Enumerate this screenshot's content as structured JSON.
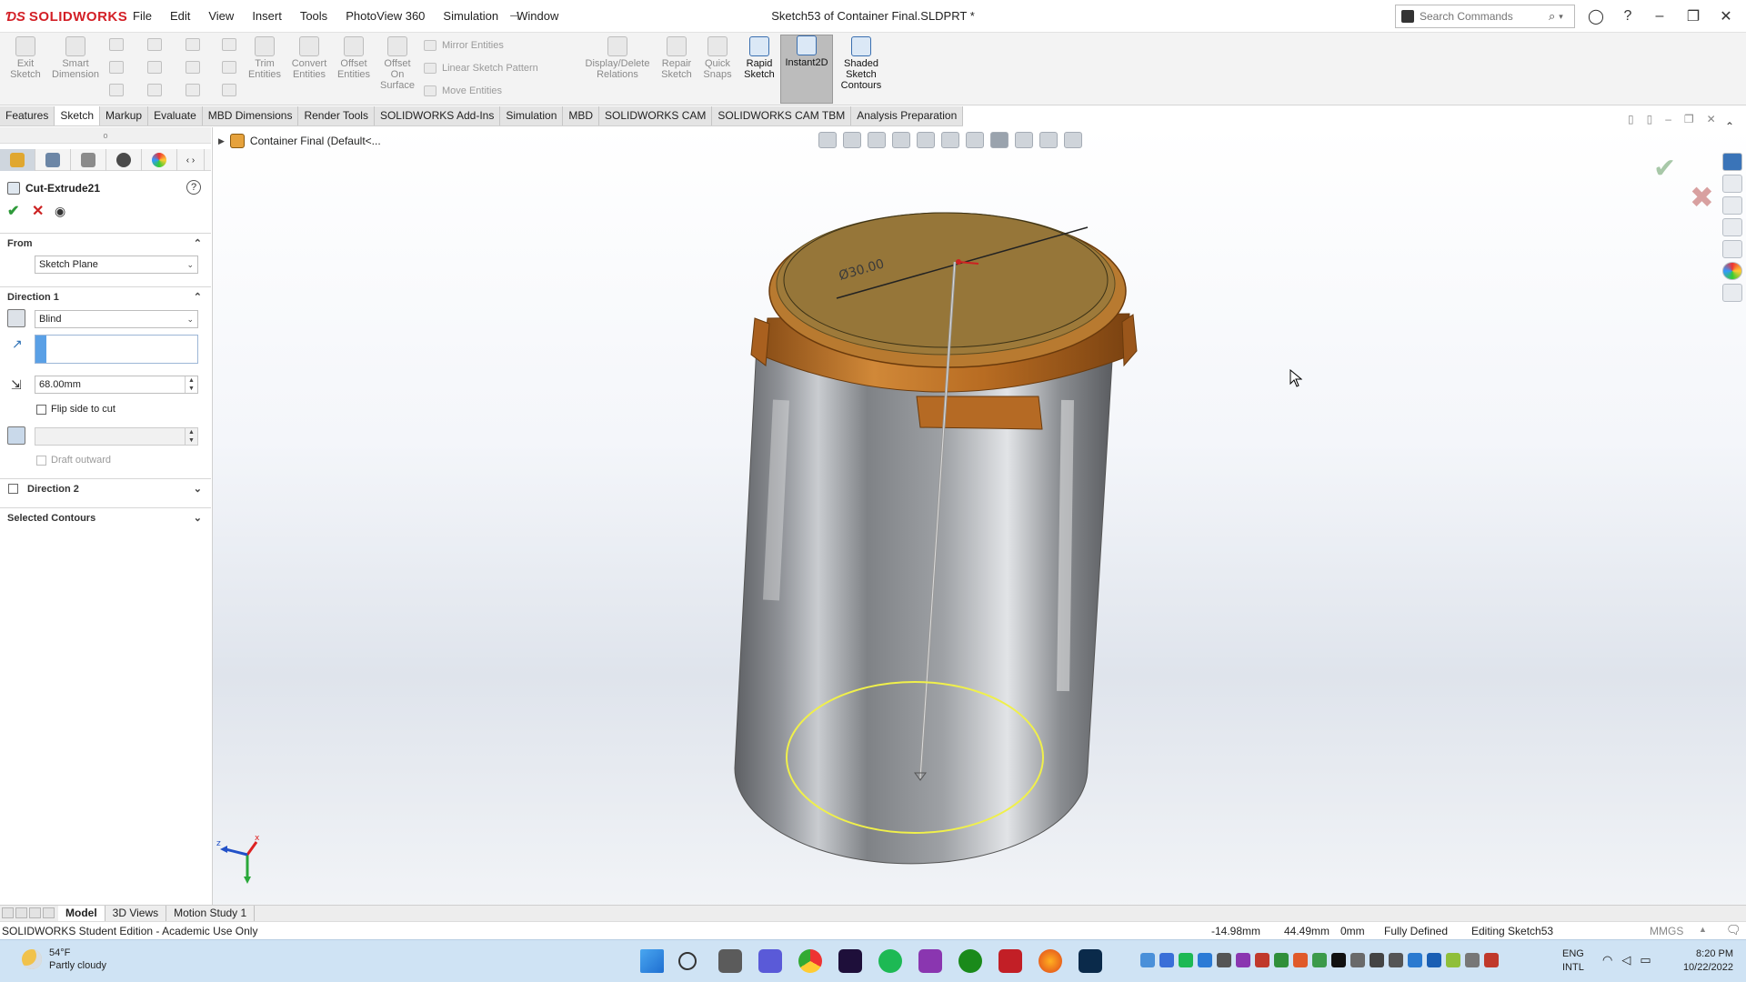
{
  "app": {
    "name": "SOLIDWORKS",
    "doc_title": "Sketch53 of Container Final.SLDPRT *"
  },
  "menu": [
    "File",
    "Edit",
    "View",
    "Insert",
    "Tools",
    "PhotoView 360",
    "Simulation",
    "Window"
  ],
  "search": {
    "placeholder": "Search Commands"
  },
  "command_manager": {
    "exit_sketch": "Exit Sketch",
    "smart_dimension": "Smart Dimension",
    "trim_entities": "Trim Entities",
    "convert_entities": "Convert Entities",
    "offset_entities": "Offset Entities",
    "offset_on_surface": "Offset On Surface",
    "mirror_entities": "Mirror Entities",
    "linear_sketch_pattern": "Linear Sketch Pattern",
    "move_entities": "Move Entities",
    "display_delete_relations": "Display/Delete Relations",
    "repair_sketch": "Repair Sketch",
    "quick_snaps": "Quick Snaps",
    "rapid_sketch": "Rapid Sketch",
    "instant2d": "Instant2D",
    "shaded_sketch_contours": "Shaded Sketch Contours"
  },
  "tabs": [
    "Features",
    "Sketch",
    "Markup",
    "Evaluate",
    "MBD Dimensions",
    "Render Tools",
    "SOLIDWORKS Add-Ins",
    "Simulation",
    "MBD",
    "SOLIDWORKS CAM",
    "SOLIDWORKS CAM TBM",
    "Analysis Preparation"
  ],
  "property_manager": {
    "title": "Cut-Extrude21",
    "from": {
      "header": "From",
      "value": "Sketch Plane"
    },
    "direction1": {
      "header": "Direction 1",
      "end_condition": "Blind",
      "depth": "68.00mm",
      "flip_side_label": "Flip side to cut",
      "draft_outward_label": "Draft outward"
    },
    "direction2": {
      "header": "Direction 2"
    },
    "selected_contours": {
      "header": "Selected Contours"
    }
  },
  "tree": {
    "label": "Container Final  (Default<..."
  },
  "model": {
    "dimension_label": "Ø30.00"
  },
  "bottom_tabs": [
    "Model",
    "3D Views",
    "Motion Study 1"
  ],
  "status": {
    "left": "SOLIDWORKS Student Edition - Academic Use Only",
    "x": "-14.98mm",
    "y": "44.49mm",
    "z": "0mm",
    "state": "Fully Defined",
    "editing": "Editing Sketch53",
    "units": "MMGS"
  },
  "taskbar": {
    "weather_temp": "54°F",
    "weather_desc": "Partly cloudy",
    "lang1": "ENG",
    "lang2": "INTL",
    "time": "8:20 PM",
    "date": "10/22/2022"
  },
  "triad": {
    "x": "x",
    "z": "z"
  },
  "colors": {
    "accent": "#d31f26",
    "lid": "#c77a2e",
    "sketch": "#f0f04a",
    "ok": "#2e9a3a",
    "cancel": "#cc2222"
  }
}
